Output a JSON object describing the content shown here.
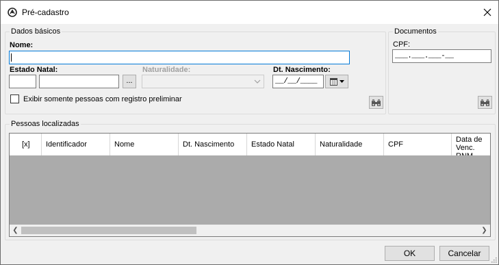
{
  "window": {
    "title": "Pré-cadastro",
    "app_icon": "app-logo-icon",
    "close_icon": "close-icon"
  },
  "dados_basicos": {
    "legend": "Dados básicos",
    "nome_label": "Nome:",
    "nome_value": "",
    "estado_natal_label": "Estado Natal:",
    "estado_code_value": "",
    "estado_name_value": "",
    "ellipsis_label": "...",
    "naturalidade_label": "Naturalidade:",
    "naturalidade_value": "",
    "dt_nascimento_label": "Dt. Nascimento:",
    "dt_nascimento_mask": "__/__/____",
    "checkbox_label": "Exibir somente pessoas com registro preliminar",
    "checkbox_checked": false,
    "find_icon": "binoculars-icon"
  },
  "documentos": {
    "legend": "Documentos",
    "cpf_label": "CPF:",
    "cpf_mask": "___.___.___-__",
    "find_icon": "binoculars-icon"
  },
  "pessoas_localizadas": {
    "legend": "Pessoas localizadas",
    "columns": [
      "[x]",
      "Identificador",
      "Nome",
      "Dt. Nascimento",
      "Estado Natal",
      "Naturalidade",
      "CPF",
      "Data de Venc. RNM"
    ],
    "rows": []
  },
  "buttons": {
    "ok": "OK",
    "cancelar": "Cancelar"
  }
}
